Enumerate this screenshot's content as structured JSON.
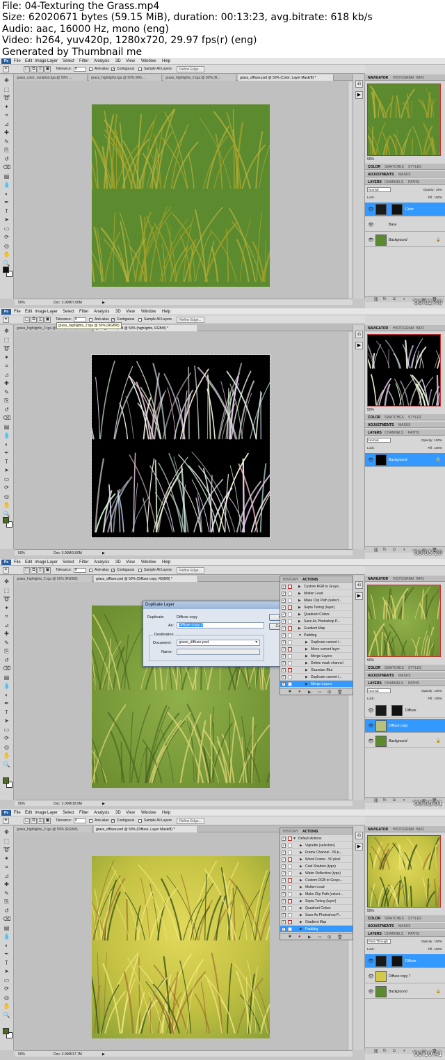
{
  "header": {
    "file": "File: 04-Texturing the Grass.mp4",
    "size": "Size: 62020671 bytes (59.15 MiB), duration: 00:13:23, avg.bitrate: 618 kb/s",
    "audio": "Audio: aac, 16000 Hz, mono (eng)",
    "video": "Video: h264, yuv420p, 1280x720, 29.97 fps(r) (eng)",
    "generated": "Generated by Thumbnail me"
  },
  "menu": {
    "ps": "Ps",
    "file": "File",
    "edit": "Edit",
    "image": "Image",
    "layer": "Layer",
    "select": "Select",
    "filter": "Filter",
    "analysis": "Analysis",
    "threed": "3D",
    "view": "View",
    "window": "Window",
    "help": "Help"
  },
  "options": {
    "tolerance_label": "Tolerance:",
    "tolerance_value": "0",
    "antialias": "Anti-alias",
    "contiguous": "Contiguous",
    "sample_all": "Sample All Layers",
    "refine_edge": "Refine Edge..."
  },
  "panel_tabs": {
    "navigator": "NAVIGATOR",
    "histogram": "HISTOGRAM",
    "info": "INFO",
    "color": "COLOR",
    "swatches": "SWATCHES",
    "styles": "STYLES",
    "adjustments": "ADJUSTMENTS",
    "masks": "MASKS",
    "layers": "LAYERS",
    "channels": "CHANNELS",
    "paths": "PATHS",
    "lock": "Lock:",
    "fill": "Fill:",
    "opacity_label": "Opacity:",
    "history": "HISTORY",
    "actions": "ACTIONS"
  },
  "frames": [
    {
      "tabs": [
        "grass_color_variation.tga @ 50% ...",
        "grass_highlights.tga @ 50% (RG...",
        "grass_highlights_2.tga @ 50% (R...",
        "grass_diffuse.psd @ 50% (Color, Layer Mask/8) *"
      ],
      "zoom": "50%",
      "doc": "Doc: 3.00M/7.00M",
      "nav_zoom": "50%",
      "blend": "Normal",
      "opacity": "25%",
      "fill": "100%",
      "layers": [
        "Color",
        "Base",
        "Background"
      ],
      "timestamp": "00:02:40"
    },
    {
      "tabs": [
        "grass_highlights_2.tga @ 50% (RGB/8)",
        "grass_diffuse.psd @ 50% (highlights, RGB/8) *"
      ],
      "tooltip": "grass_highlights_2.tga @ 50% (RGB/8)",
      "zoom": "50%",
      "doc": "Doc: 3.00M/3.00M",
      "nav_zoom": "50%",
      "blend": "Normal",
      "opacity": "100%",
      "fill": "100%",
      "layers": [
        "Background"
      ],
      "timestamp": "00:05:20"
    },
    {
      "tabs": [
        "grass_highlights_2.tga @ 50% (RGB/8)",
        "grass_diffuse.psd @ 50% (Diffuse copy, RGB/8) *"
      ],
      "zoom": "50%",
      "doc": "Doc: 3.00M/18.0M",
      "nav_zoom": "50%",
      "blend": "Normal",
      "opacity": "100%",
      "fill": "100%",
      "layers": [
        "Diffuse",
        "Diffuse copy",
        "Background"
      ],
      "timestamp": "00:08:01",
      "dialog": {
        "title": "Duplicate Layer",
        "duplicate_label": "Duplicate:",
        "duplicate_value": "Diffuse copy",
        "as_label": "As:",
        "as_value": "Diffuse copy 2",
        "ok": "OK",
        "cancel": "Cancel",
        "destination": "Destination",
        "document_label": "Document:",
        "document_value": "grass_diffuse.psd",
        "name_label": "Name:"
      },
      "actions": [
        "Custom RGB to Grays...",
        "Molten Lead",
        "Make Clip Path (select...",
        "Sepia Toning (layer)",
        "Quadrant Colors",
        "Save As Photoshop P...",
        "Gradient Map",
        "Padding",
        "Duplicate current l...",
        "Move current layer",
        "Merge Layers",
        "Delete mask channel",
        "Gaussian Blur",
        "Duplicate current l...",
        "Merge Layers"
      ]
    },
    {
      "tabs": [
        "grass_highlights_2.tga @ 50% (RGB/8)",
        "grass_diffuse.psd @ 50% (Diffuse, Layer Mask/8) *"
      ],
      "zoom": "50%",
      "doc": "Doc: 3.00M/17.7M",
      "nav_zoom": "50%",
      "blend": "Pass Through",
      "opacity": "100%",
      "fill": "100%",
      "layers": [
        "Diffuse",
        "Diffuse copy 7",
        "Background"
      ],
      "timestamp": "00:10:41",
      "actions": [
        "Default Actions",
        "Vignette (selection)",
        "Frame Channel - 50 p...",
        "Wood Frame - 50 pixel",
        "Cast Shadow (type)",
        "Water Reflection (type)",
        "Custom RGB to Grays...",
        "Molten Lead",
        "Make Clip Path (select...",
        "Sepia Toning (layer)",
        "Quadrant Colors",
        "Save As Photoshop P...",
        "Gradient Map",
        "Padding"
      ]
    }
  ],
  "colors": {
    "grass_green": "#5b8a2f",
    "selection_blue": "#3399ff",
    "ui_gray": "#c6c6c6"
  }
}
